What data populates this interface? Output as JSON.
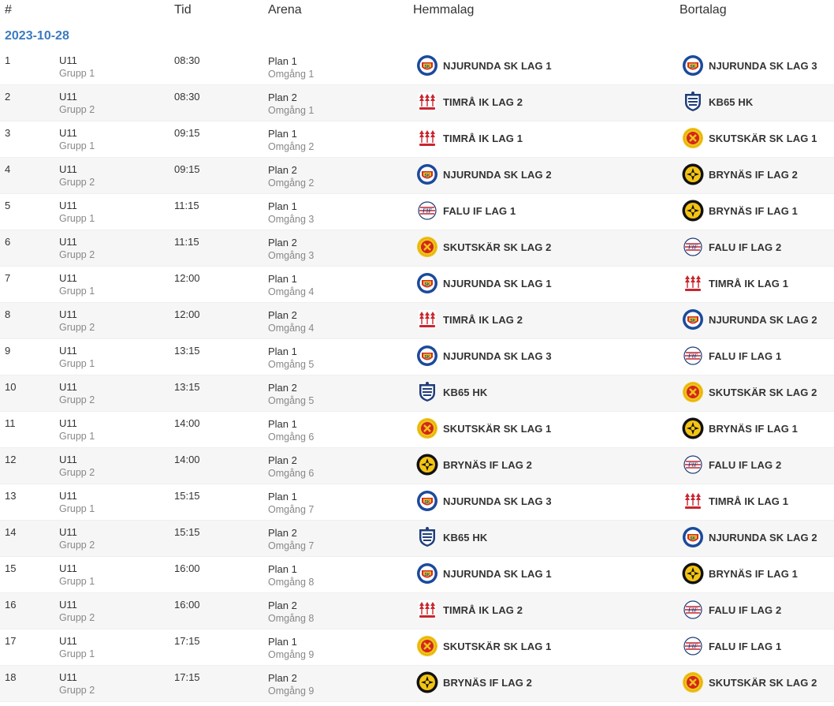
{
  "columns": {
    "num": "#",
    "time": "Tid",
    "arena": "Arena",
    "home": "Hemmalag",
    "away": "Bortalag"
  },
  "date": "2023-10-28",
  "logos": {
    "njurunda": {
      "icon": "njurunda-sk-logo-icon",
      "colors": [
        "#1a4a9c",
        "#e8c21a",
        "#d42b2b"
      ]
    },
    "timra": {
      "icon": "timra-ik-logo-icon",
      "colors": [
        "#c8252d",
        "#ffffff"
      ]
    },
    "kb65": {
      "icon": "kb65-hk-logo-icon",
      "colors": [
        "#1f3e7a",
        "#ffffff"
      ]
    },
    "skutskar": {
      "icon": "skutskar-sk-logo-icon",
      "colors": [
        "#f2c316",
        "#d3261f"
      ]
    },
    "brynas": {
      "icon": "brynas-if-logo-icon",
      "colors": [
        "#111111",
        "#f4c414"
      ]
    },
    "falu": {
      "icon": "falu-if-logo-icon",
      "colors": [
        "#c8252d",
        "#ffffff",
        "#1f3e7a"
      ]
    }
  },
  "matches": [
    {
      "num": "1",
      "age": "U11",
      "group": "Grupp 1",
      "time": "08:30",
      "arena": "Plan 1",
      "round": "Omgång 1",
      "home": {
        "name": "NJURUNDA SK LAG 1",
        "logo": "njurunda"
      },
      "away": {
        "name": "NJURUNDA SK LAG 3",
        "logo": "njurunda"
      }
    },
    {
      "num": "2",
      "age": "U11",
      "group": "Grupp 2",
      "time": "08:30",
      "arena": "Plan 2",
      "round": "Omgång 1",
      "home": {
        "name": "TIMRÅ IK LAG 2",
        "logo": "timra"
      },
      "away": {
        "name": "KB65 HK",
        "logo": "kb65"
      }
    },
    {
      "num": "3",
      "age": "U11",
      "group": "Grupp 1",
      "time": "09:15",
      "arena": "Plan 1",
      "round": "Omgång 2",
      "home": {
        "name": "TIMRÅ IK LAG 1",
        "logo": "timra"
      },
      "away": {
        "name": "SKUTSKÄR SK LAG 1",
        "logo": "skutskar"
      }
    },
    {
      "num": "4",
      "age": "U11",
      "group": "Grupp 2",
      "time": "09:15",
      "arena": "Plan 2",
      "round": "Omgång 2",
      "home": {
        "name": "NJURUNDA SK LAG 2",
        "logo": "njurunda"
      },
      "away": {
        "name": "BRYNÄS IF LAG 2",
        "logo": "brynas"
      }
    },
    {
      "num": "5",
      "age": "U11",
      "group": "Grupp 1",
      "time": "11:15",
      "arena": "Plan 1",
      "round": "Omgång 3",
      "home": {
        "name": "FALU IF LAG 1",
        "logo": "falu"
      },
      "away": {
        "name": "BRYNÄS IF LAG 1",
        "logo": "brynas"
      }
    },
    {
      "num": "6",
      "age": "U11",
      "group": "Grupp 2",
      "time": "11:15",
      "arena": "Plan 2",
      "round": "Omgång 3",
      "home": {
        "name": "SKUTSKÄR SK LAG 2",
        "logo": "skutskar"
      },
      "away": {
        "name": "FALU IF LAG 2",
        "logo": "falu"
      }
    },
    {
      "num": "7",
      "age": "U11",
      "group": "Grupp 1",
      "time": "12:00",
      "arena": "Plan 1",
      "round": "Omgång 4",
      "home": {
        "name": "NJURUNDA SK LAG 1",
        "logo": "njurunda"
      },
      "away": {
        "name": "TIMRÅ IK LAG 1",
        "logo": "timra"
      }
    },
    {
      "num": "8",
      "age": "U11",
      "group": "Grupp 2",
      "time": "12:00",
      "arena": "Plan 2",
      "round": "Omgång 4",
      "home": {
        "name": "TIMRÅ IK LAG 2",
        "logo": "timra"
      },
      "away": {
        "name": "NJURUNDA SK LAG 2",
        "logo": "njurunda"
      }
    },
    {
      "num": "9",
      "age": "U11",
      "group": "Grupp 1",
      "time": "13:15",
      "arena": "Plan 1",
      "round": "Omgång 5",
      "home": {
        "name": "NJURUNDA SK LAG 3",
        "logo": "njurunda"
      },
      "away": {
        "name": "FALU IF LAG 1",
        "logo": "falu"
      }
    },
    {
      "num": "10",
      "age": "U11",
      "group": "Grupp 2",
      "time": "13:15",
      "arena": "Plan 2",
      "round": "Omgång 5",
      "home": {
        "name": "KB65 HK",
        "logo": "kb65"
      },
      "away": {
        "name": "SKUTSKÄR SK LAG 2",
        "logo": "skutskar"
      }
    },
    {
      "num": "11",
      "age": "U11",
      "group": "Grupp 1",
      "time": "14:00",
      "arena": "Plan 1",
      "round": "Omgång 6",
      "home": {
        "name": "SKUTSKÄR SK LAG 1",
        "logo": "skutskar"
      },
      "away": {
        "name": "BRYNÄS IF LAG 1",
        "logo": "brynas"
      }
    },
    {
      "num": "12",
      "age": "U11",
      "group": "Grupp 2",
      "time": "14:00",
      "arena": "Plan 2",
      "round": "Omgång 6",
      "home": {
        "name": "BRYNÄS IF LAG 2",
        "logo": "brynas"
      },
      "away": {
        "name": "FALU IF LAG 2",
        "logo": "falu"
      }
    },
    {
      "num": "13",
      "age": "U11",
      "group": "Grupp 1",
      "time": "15:15",
      "arena": "Plan 1",
      "round": "Omgång 7",
      "home": {
        "name": "NJURUNDA SK LAG 3",
        "logo": "njurunda"
      },
      "away": {
        "name": "TIMRÅ IK LAG 1",
        "logo": "timra"
      }
    },
    {
      "num": "14",
      "age": "U11",
      "group": "Grupp 2",
      "time": "15:15",
      "arena": "Plan 2",
      "round": "Omgång 7",
      "home": {
        "name": "KB65 HK",
        "logo": "kb65"
      },
      "away": {
        "name": "NJURUNDA SK LAG 2",
        "logo": "njurunda"
      }
    },
    {
      "num": "15",
      "age": "U11",
      "group": "Grupp 1",
      "time": "16:00",
      "arena": "Plan 1",
      "round": "Omgång 8",
      "home": {
        "name": "NJURUNDA SK LAG 1",
        "logo": "njurunda"
      },
      "away": {
        "name": "BRYNÄS IF LAG 1",
        "logo": "brynas"
      }
    },
    {
      "num": "16",
      "age": "U11",
      "group": "Grupp 2",
      "time": "16:00",
      "arena": "Plan 2",
      "round": "Omgång 8",
      "home": {
        "name": "TIMRÅ IK LAG 2",
        "logo": "timra"
      },
      "away": {
        "name": "FALU IF LAG 2",
        "logo": "falu"
      }
    },
    {
      "num": "17",
      "age": "U11",
      "group": "Grupp 1",
      "time": "17:15",
      "arena": "Plan 1",
      "round": "Omgång 9",
      "home": {
        "name": "SKUTSKÄR SK LAG 1",
        "logo": "skutskar"
      },
      "away": {
        "name": "FALU IF LAG 1",
        "logo": "falu"
      }
    },
    {
      "num": "18",
      "age": "U11",
      "group": "Grupp 2",
      "time": "17:15",
      "arena": "Plan 2",
      "round": "Omgång 9",
      "home": {
        "name": "BRYNÄS IF LAG 2",
        "logo": "brynas"
      },
      "away": {
        "name": "SKUTSKÄR SK LAG 2",
        "logo": "skutskar"
      }
    }
  ]
}
